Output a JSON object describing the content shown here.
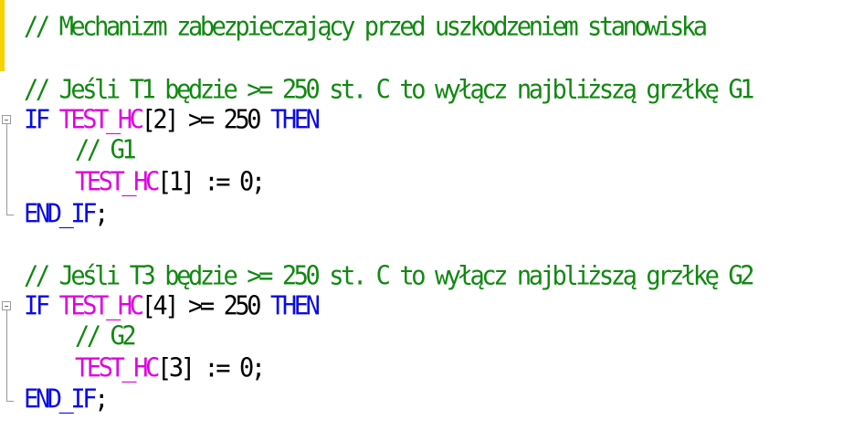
{
  "editor": {
    "lines": {
      "l1": {
        "comment": "// Mechanizm zabezpieczający przed uszkodzeniem stanowiska"
      },
      "l2": {
        "comment": "// Jeśli T1 będzie >= 250 st. C to wyłącz najbliższą grzłkę G1"
      },
      "l3": {
        "kw_if": "IF",
        "ident": "TEST_HC",
        "rest": "[2] >= 250",
        "kw_then": "THEN"
      },
      "l4": {
        "comment": "// G1"
      },
      "l5": {
        "ident": "TEST_HC",
        "rest": "[1] := 0;"
      },
      "l6": {
        "kw_end": "END_IF",
        "semi": ";"
      },
      "l7": {
        "comment": "// Jeśli T3 będzie >= 250 st. C to wyłącz najbliższą grzłkę G2"
      },
      "l8": {
        "kw_if": "IF",
        "ident": "TEST_HC",
        "rest": "[4] >= 250",
        "kw_then": "THEN"
      },
      "l9": {
        "comment": "// G2"
      },
      "l10": {
        "ident": "TEST_HC",
        "rest": "[3] := 0;"
      },
      "l11": {
        "kw_end": "END_IF",
        "semi": ";"
      }
    },
    "colors": {
      "comment": "#118811",
      "keyword": "#0a0ae6",
      "identifier": "#e000e0",
      "text": "#000000",
      "change_marker": "#f5d200"
    },
    "icons": [
      "fold-collapse-icon",
      "fold-end-icon"
    ]
  }
}
